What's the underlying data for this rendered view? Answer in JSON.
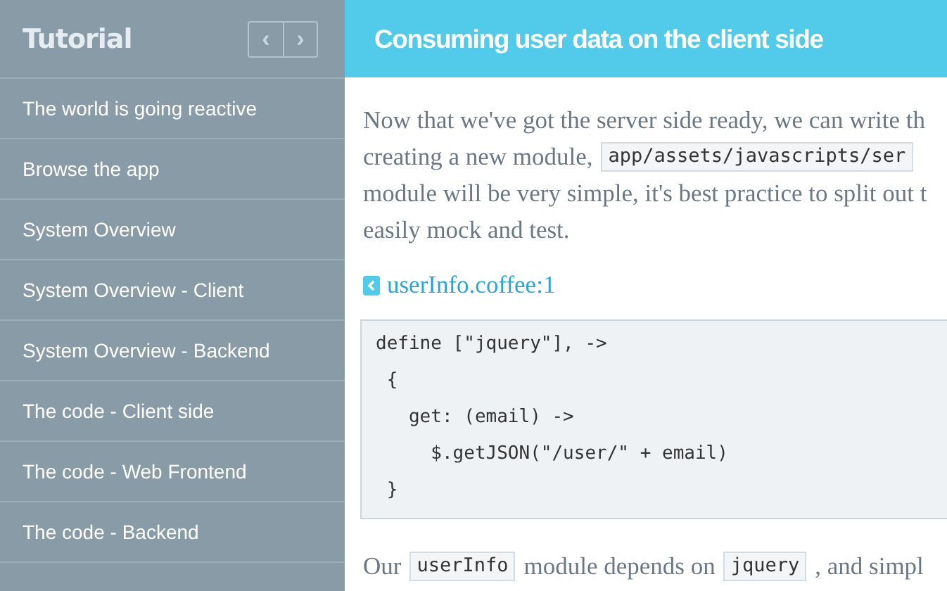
{
  "sidebar": {
    "title": "Tutorial",
    "nav_buttons": [
      "‹",
      "›"
    ],
    "items": [
      {
        "label": "The world is going reactive"
      },
      {
        "label": "Browse the app"
      },
      {
        "label": "System Overview"
      },
      {
        "label": "System Overview - Client"
      },
      {
        "label": "System Overview - Backend"
      },
      {
        "label": "The code - Client side"
      },
      {
        "label": "The code - Web Frontend"
      },
      {
        "label": "The code - Backend"
      }
    ]
  },
  "main": {
    "title": "Consuming user data on the client side",
    "paragraph": [
      {
        "parts": [
          {
            "kind": "text",
            "text": "Now that we've got the server side ready, we can write th"
          }
        ]
      },
      {
        "parts": [
          {
            "kind": "text",
            "text": "creating a new module,"
          },
          {
            "kind": "code",
            "text": "app/assets/javascripts/ser"
          }
        ]
      },
      {
        "parts": [
          {
            "kind": "text",
            "text": "module will be very simple, it's best practice to split out t"
          }
        ]
      },
      {
        "parts": [
          {
            "kind": "text",
            "text": "easily mock and test."
          }
        ]
      }
    ],
    "source_link": "userInfo.coffee:1",
    "code": [
      "define [\"jquery\"], ->",
      " {",
      "   get: (email) ->",
      "     $.getJSON(\"/user/\" + email)",
      " }"
    ],
    "after": [
      {
        "kind": "text",
        "text": "Our"
      },
      {
        "kind": "code",
        "text": "userInfo"
      },
      {
        "kind": "text",
        "text": "module depends on"
      },
      {
        "kind": "code",
        "text": "jquery"
      },
      {
        "kind": "text",
        "text": ", and simpl"
      }
    ]
  }
}
